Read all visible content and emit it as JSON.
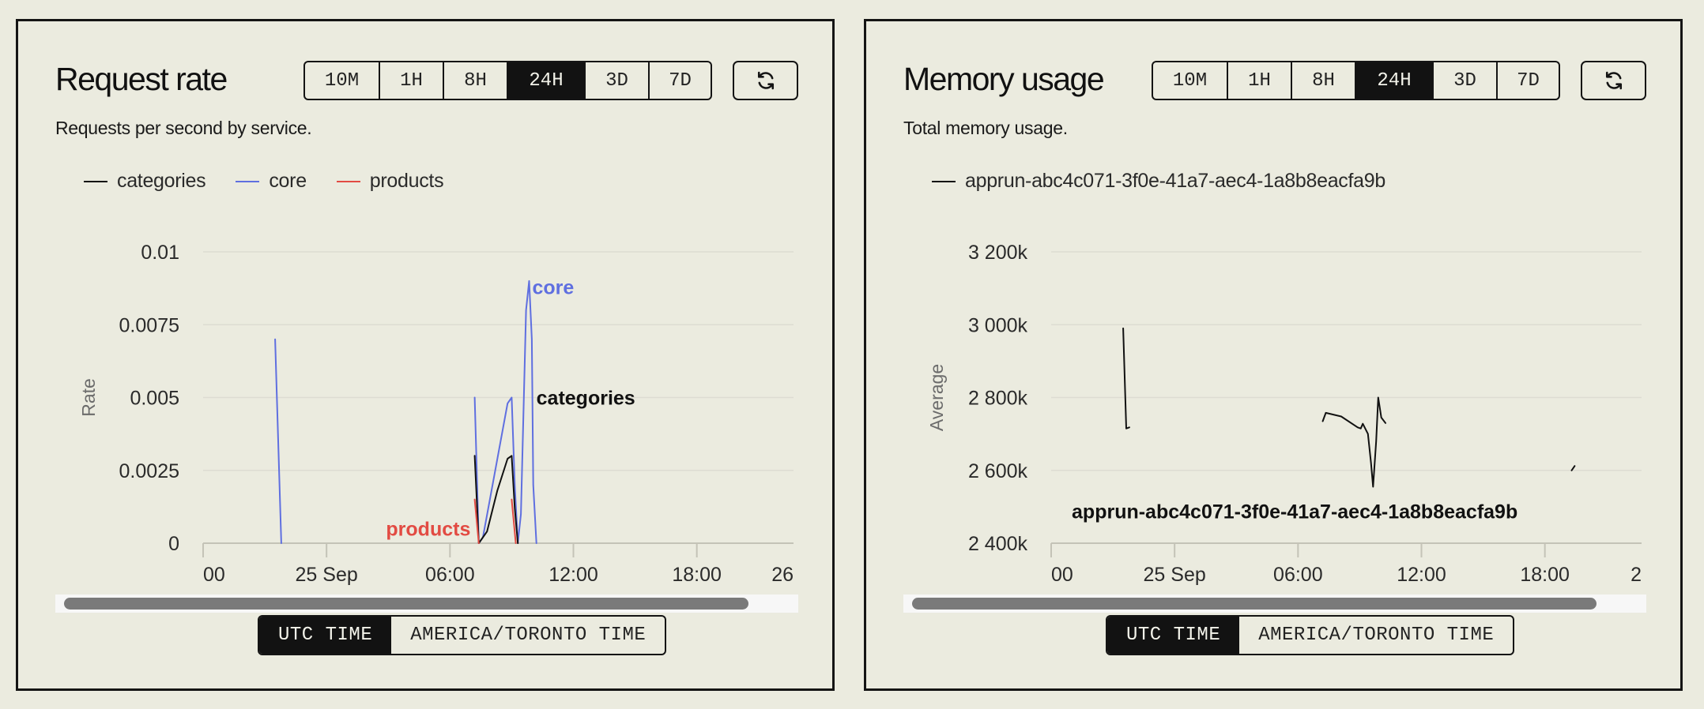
{
  "range_options": [
    "10M",
    "1H",
    "8H",
    "24H",
    "3D",
    "7D"
  ],
  "active_range": "24H",
  "timezone_options": [
    "UTC TIME",
    "AMERICA/TORONTO TIME"
  ],
  "active_timezone": "UTC TIME",
  "refresh_icon": "refresh-icon",
  "panels": {
    "request_rate": {
      "title": "Request rate",
      "subtitle": "Requests per second by service.",
      "legend": [
        {
          "name": "categories",
          "color": "#111111"
        },
        {
          "name": "core",
          "color": "#5f6fe0"
        },
        {
          "name": "products",
          "color": "#e24b43"
        }
      ]
    },
    "memory_usage": {
      "title": "Memory usage",
      "subtitle": "Total memory usage.",
      "legend": [
        {
          "name": "apprun-abc4c071-3f0e-41a7-aec4-1a8b8eacfa9b",
          "color": "#111111"
        }
      ]
    }
  },
  "chart_data": [
    {
      "type": "line",
      "title": "Request rate",
      "xlabel": "",
      "ylabel": "Rate",
      "x_unit": "hours since 24 Sep 18:00 UTC",
      "xlim": [
        0,
        28.7
      ],
      "ylim": [
        0,
        0.01
      ],
      "grid": true,
      "legend_position": "top-left",
      "x_ticks": [
        {
          "x": 0,
          "label": "00"
        },
        {
          "x": 6,
          "label": "25 Sep"
        },
        {
          "x": 12,
          "label": "06:00"
        },
        {
          "x": 18,
          "label": "12:00"
        },
        {
          "x": 24,
          "label": "18:00"
        },
        {
          "x": 28.1,
          "label": "26"
        }
      ],
      "y_ticks": [
        {
          "y": 0,
          "label": "0"
        },
        {
          "y": 0.0025,
          "label": "0.0025"
        },
        {
          "y": 0.005,
          "label": "0.005"
        },
        {
          "y": 0.0075,
          "label": "0.0075"
        },
        {
          "y": 0.01,
          "label": "0.01"
        }
      ],
      "series": [
        {
          "name": "core",
          "color": "#5f6fe0",
          "segments": [
            [
              [
                3.5,
                0.007
              ],
              [
                3.8,
                0
              ]
            ],
            [
              [
                13.2,
                0.005
              ],
              [
                13.4,
                0
              ],
              [
                13.6,
                0.0002
              ],
              [
                14.2,
                0.0025
              ],
              [
                14.8,
                0.0048
              ],
              [
                15.0,
                0.005
              ],
              [
                15.15,
                0.002
              ],
              [
                15.3,
                0
              ],
              [
                15.45,
                0.001
              ],
              [
                15.7,
                0.008
              ],
              [
                15.85,
                0.009
              ],
              [
                15.98,
                0.007
              ],
              [
                16.05,
                0.002
              ],
              [
                16.2,
                0
              ]
            ]
          ],
          "label": {
            "text": "core",
            "x": 16.0,
            "y": 0.0088
          }
        },
        {
          "name": "categories",
          "color": "#111111",
          "segments": [
            [
              [
                13.2,
                0.003
              ],
              [
                13.4,
                0
              ],
              [
                13.8,
                0.0004
              ],
              [
                14.3,
                0.0018
              ],
              [
                14.8,
                0.0029
              ],
              [
                15.0,
                0.003
              ],
              [
                15.15,
                0.0012
              ],
              [
                15.3,
                0
              ]
            ]
          ],
          "label": {
            "text": "categories",
            "x": 16.2,
            "y": 0.005
          }
        },
        {
          "name": "products",
          "color": "#e24b43",
          "segments": [
            [
              [
                13.2,
                0.0015
              ],
              [
                13.4,
                0
              ]
            ],
            [
              [
                15.0,
                0.0015
              ],
              [
                15.2,
                0
              ]
            ]
          ],
          "label": {
            "text": "products",
            "x": 13.0,
            "y": 0.0005
          }
        }
      ]
    },
    {
      "type": "line",
      "title": "Memory usage",
      "xlabel": "",
      "ylabel": "Average",
      "x_unit": "hours since 24 Sep 18:00 UTC",
      "xlim": [
        0,
        28.7
      ],
      "ylim": [
        2400,
        3200
      ],
      "y_unit": "k",
      "grid": true,
      "legend_position": "top-left",
      "x_ticks": [
        {
          "x": 0,
          "label": "00"
        },
        {
          "x": 6,
          "label": "25 Sep"
        },
        {
          "x": 12,
          "label": "06:00"
        },
        {
          "x": 18,
          "label": "12:00"
        },
        {
          "x": 24,
          "label": "18:00"
        },
        {
          "x": 28.3,
          "label": "2"
        }
      ],
      "y_ticks": [
        {
          "y": 2400,
          "label": "2 400k"
        },
        {
          "y": 2600,
          "label": "2 600k"
        },
        {
          "y": 2800,
          "label": "2 800k"
        },
        {
          "y": 3000,
          "label": "3 000k"
        },
        {
          "y": 3200,
          "label": "3 200k"
        }
      ],
      "series": [
        {
          "name": "apprun-abc4c071-3f0e-41a7-aec4-1a8b8eacfa9b",
          "color": "#111111",
          "segments": [
            [
              [
                3.5,
                2990
              ],
              [
                3.65,
                2715
              ],
              [
                3.8,
                2718
              ]
            ],
            [
              [
                13.2,
                2735
              ],
              [
                13.35,
                2758
              ],
              [
                14.1,
                2748
              ],
              [
                14.9,
                2718
              ],
              [
                15.05,
                2715
              ],
              [
                15.15,
                2728
              ],
              [
                15.4,
                2700
              ],
              [
                15.55,
                2620
              ],
              [
                15.65,
                2555
              ],
              [
                15.8,
                2680
              ],
              [
                15.9,
                2800
              ],
              [
                16.05,
                2745
              ],
              [
                16.25,
                2730
              ]
            ],
            [
              [
                25.3,
                2600
              ],
              [
                25.45,
                2612
              ]
            ]
          ],
          "label": {
            "text": "apprun-abc4c071-3f0e-41a7-aec4-1a8b8eacfa9b",
            "x": 1.0,
            "y": 2488
          }
        }
      ]
    }
  ]
}
